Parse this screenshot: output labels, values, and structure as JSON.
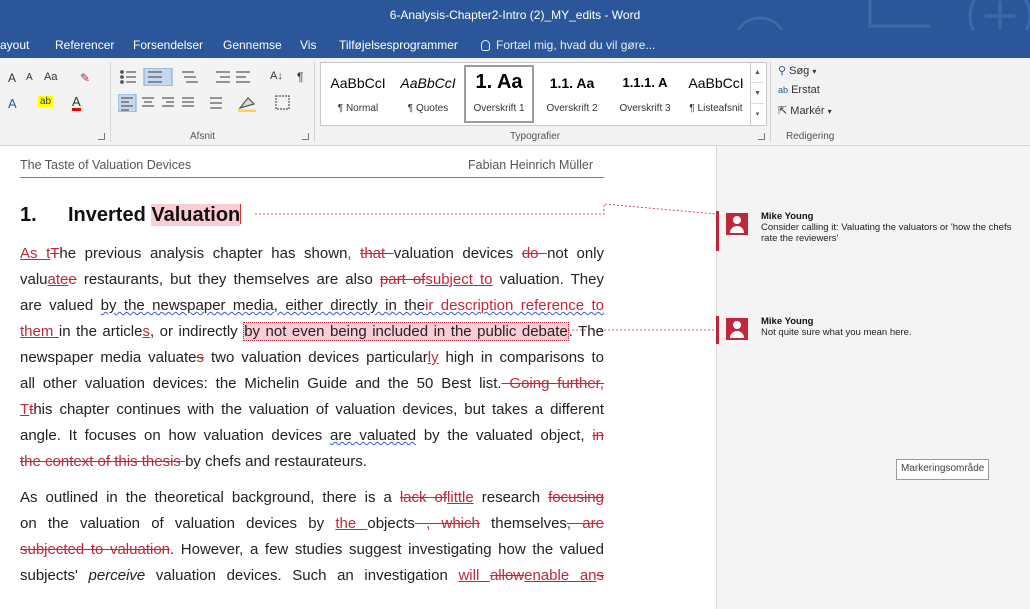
{
  "window": {
    "title": "6-Analysis-Chapter2-Intro (2)_MY_edits - Word"
  },
  "menu": {
    "tabs": [
      "ayout",
      "Referencer",
      "Forsendelser",
      "Gennemse",
      "Vis",
      "Tilføjelsesprogrammer"
    ],
    "tell_me": "Fortæl mig, hvad du vil gøre..."
  },
  "ribbon": {
    "font_tools": {
      "grow": "A",
      "shrink": "A",
      "case": "Aa",
      "effects": "A",
      "highlight": "ab",
      "color": "A"
    },
    "paragraph_label": "Afsnit",
    "styles_label": "Typografier",
    "editing_label": "Redigering",
    "styles": [
      {
        "preview": "AaBbCcI",
        "name": "¶ Normal"
      },
      {
        "preview": "AaBbCcI",
        "name": "¶ Quotes"
      },
      {
        "preview": "1.  Aa",
        "name": "Overskrift 1"
      },
      {
        "preview": "1.1.  Aa",
        "name": "Overskrift 2"
      },
      {
        "preview": "1.1.1.  A",
        "name": "Overskrift 3"
      },
      {
        "preview": "AaBbCcI",
        "name": "¶ Listeafsnit"
      }
    ],
    "editing": {
      "find": "Søg",
      "replace": "Erstat",
      "select": "Markér"
    },
    "sort_glyph": "A↓",
    "pilcrow": "¶"
  },
  "document": {
    "header_left": "The Taste of Valuation Devices",
    "header_right": "Fabian Heinrich Müller",
    "heading_number": "1.",
    "heading_text": "Inverted ",
    "heading_highlight": "Valuation",
    "p1": {
      "l1": [
        "As t",
        "T",
        "he previous analysis chapter has shown",
        ",",
        " ",
        "that ",
        "valuation devices ",
        "do ",
        "not only"
      ],
      "l2": [
        "valu",
        "ate",
        "e",
        " restaurants, but they themselves are also ",
        "part of",
        "subject to",
        " valuation. They"
      ],
      "l3": [
        "are valued ",
        "by the newspaper media, either directly in the",
        "ir description reference to"
      ],
      "l4": [
        "them ",
        "in the article",
        "s",
        ", or indirectly ",
        "by not even being included in the public debate",
        ". The"
      ],
      "l5": [
        "newspaper media valuate",
        "s",
        " two valuation devices particular",
        "ly",
        " high in comparisons to"
      ],
      "l6": [
        "all other valuation devices: the Michelin Guide and the 50 Best list.",
        " Going further,"
      ],
      "l7": [
        "T",
        "t",
        "his chapter continues with the valuation of valuation devices, but takes a different"
      ],
      "l8": [
        "angle. It focuses on how valuation devices ",
        "are valuated",
        " by the valuated object, ",
        "in"
      ],
      "l9": [
        "the context of this thesis ",
        "by chefs and restaurateurs."
      ]
    },
    "p2": {
      "l1": [
        "As outlined in the theoretical background, there is a ",
        "lack of",
        "little",
        " research ",
        "focusing"
      ],
      "l2": [
        "on the valuation of valuation devices by ",
        "the ",
        "objects",
        " , which",
        " themselves",
        ", are"
      ],
      "l3": [
        "subjected to valuation",
        ". However, a few studies suggest investigating how the valued"
      ],
      "l4": [
        "subjects' ",
        "perceive",
        " valuation devices. Such an investigation ",
        "will ",
        "allow",
        "enable an",
        "s"
      ]
    }
  },
  "comments": [
    {
      "author": "Mike Young",
      "text": "Consider calling it: Valuating the valuators or 'how the chefs rate the reviewers'"
    },
    {
      "author": "Mike Young",
      "text": "Not quite sure what you mean here."
    }
  ],
  "tooltip": "Markeringsområde",
  "colors": {
    "ribbon_blue": "#2b579a",
    "revision_red": "#c1273a",
    "comment_highlight": "#f9cdd3"
  }
}
